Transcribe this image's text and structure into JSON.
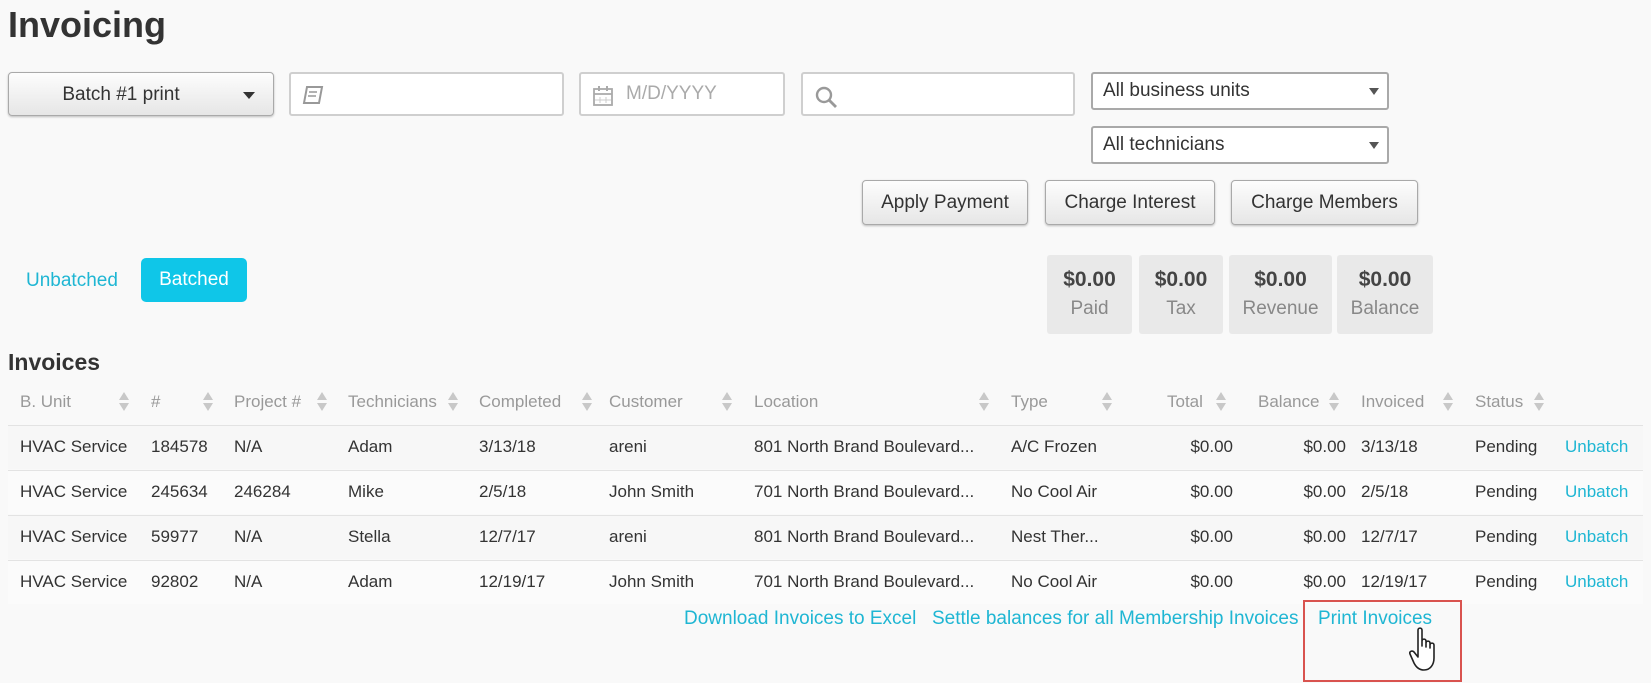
{
  "page": {
    "title": "Invoicing"
  },
  "toolbar": {
    "batch_select": "Batch #1 print",
    "date_placeholder": "M/D/YYYY",
    "business_units": "All business units",
    "technicians": "All technicians",
    "actions": [
      "Apply Payment",
      "Charge Interest",
      "Charge Members"
    ]
  },
  "filter": {
    "unbatched": "Unbatched",
    "batched": "Batched"
  },
  "summary": [
    {
      "amount": "$0.00",
      "label": "Paid"
    },
    {
      "amount": "$0.00",
      "label": "Tax"
    },
    {
      "amount": "$0.00",
      "label": "Revenue"
    },
    {
      "amount": "$0.00",
      "label": "Balance"
    }
  ],
  "table": {
    "title": "Invoices",
    "columns": [
      "B. Unit",
      "#",
      "Project #",
      "Technicians",
      "Completed",
      "Customer",
      "Location",
      "Type",
      "Total",
      "Balance",
      "Invoiced",
      "Status"
    ],
    "rows": [
      [
        "HVAC Service",
        "184578",
        "N/A",
        "Adam",
        "3/13/18",
        "areni",
        "801 North Brand Boulevard...",
        "A/C Frozen",
        "$0.00",
        "$0.00",
        "3/13/18",
        "Pending",
        "Unbatch"
      ],
      [
        "HVAC Service",
        "245634",
        "246284",
        "Mike",
        "2/5/18",
        "John Smith",
        "701 North Brand Boulevard...",
        "No Cool Air",
        "$0.00",
        "$0.00",
        "2/5/18",
        "Pending",
        "Unbatch"
      ],
      [
        "HVAC Service",
        "59977",
        "N/A",
        "Stella",
        "12/7/17",
        "areni",
        "801 North Brand Boulevard...",
        "Nest Ther...",
        "$0.00",
        "$0.00",
        "12/7/17",
        "Pending",
        "Unbatch"
      ],
      [
        "HVAC Service",
        "92802",
        "N/A",
        "Adam",
        "12/19/17",
        "John Smith",
        "701 North Brand Boulevard...",
        "No Cool Air",
        "$0.00",
        "$0.00",
        "12/19/17",
        "Pending",
        "Unbatch"
      ]
    ]
  },
  "footer": {
    "download": "Download Invoices to Excel",
    "settle": "Settle balances for all Membership Invoices",
    "print": "Print Invoices"
  },
  "colors": {
    "accent": "#0fc6e8",
    "link": "#1fb6d3",
    "highlight": "#d9534f"
  }
}
